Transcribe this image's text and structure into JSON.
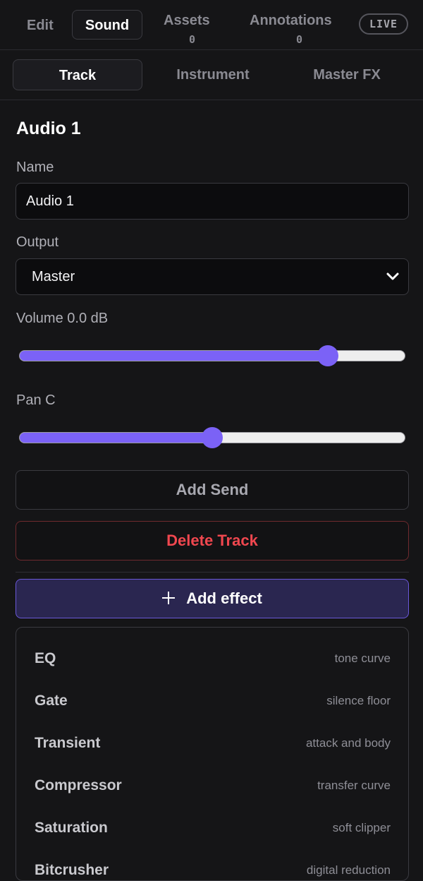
{
  "topnav": {
    "tabs": [
      {
        "label": "Edit"
      },
      {
        "label": "Sound"
      },
      {
        "label": "Assets",
        "count": "0"
      },
      {
        "label": "Annotations",
        "count": "0"
      }
    ],
    "live_badge": "LIVE"
  },
  "subtabs": [
    {
      "label": "Track"
    },
    {
      "label": "Instrument"
    },
    {
      "label": "Master FX"
    }
  ],
  "track": {
    "title": "Audio 1",
    "name_label": "Name",
    "name_value": "Audio 1",
    "output_label": "Output",
    "output_value": "Master",
    "volume_label": "Volume 0.0 dB",
    "volume_level": 0.8,
    "pan_label": "Pan C",
    "pan_level": 0.5,
    "add_send_label": "Add Send",
    "delete_track_label": "Delete Track",
    "add_effect_label": "Add effect"
  },
  "effects_menu": [
    {
      "name": "EQ",
      "desc": "tone curve"
    },
    {
      "name": "Gate",
      "desc": "silence floor"
    },
    {
      "name": "Transient",
      "desc": "attack and body"
    },
    {
      "name": "Compressor",
      "desc": "transfer curve"
    },
    {
      "name": "Saturation",
      "desc": "soft clipper"
    },
    {
      "name": "Bitcrusher",
      "desc": "digital reduction"
    }
  ],
  "colors": {
    "accent": "#7b62f6",
    "danger": "#f0474f"
  }
}
